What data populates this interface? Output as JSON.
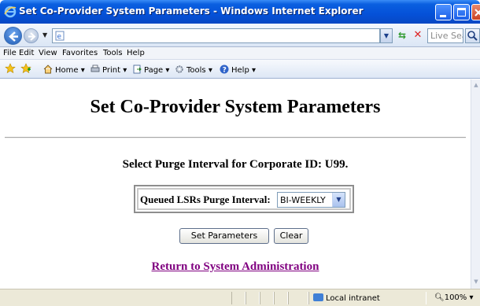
{
  "window": {
    "title": "Set Co-Provider System Parameters - Windows Internet Explorer"
  },
  "addressbar": {
    "url": "",
    "search_placeholder": "Live Search"
  },
  "menubar": {
    "items": [
      "File",
      "Edit",
      "View",
      "Favorites",
      "Tools",
      "Help"
    ]
  },
  "commandbar": {
    "home": "Home",
    "print": "Print",
    "page": "Page",
    "tools": "Tools",
    "help": "Help"
  },
  "page": {
    "title": "Set Co-Provider System Parameters",
    "subheading": "Select Purge Interval for Corporate ID: U99.",
    "purge_label": "Queued LSRs Purge Interval:",
    "purge_value": "BI-WEEKLY",
    "set_button": "Set Parameters",
    "clear_button": "Clear",
    "return_link": "Return to System Administration"
  },
  "statusbar": {
    "zone": "Local intranet",
    "zoom": "100%"
  },
  "colors": {
    "titlebar": "#0551d8",
    "visited_link": "#800080"
  }
}
